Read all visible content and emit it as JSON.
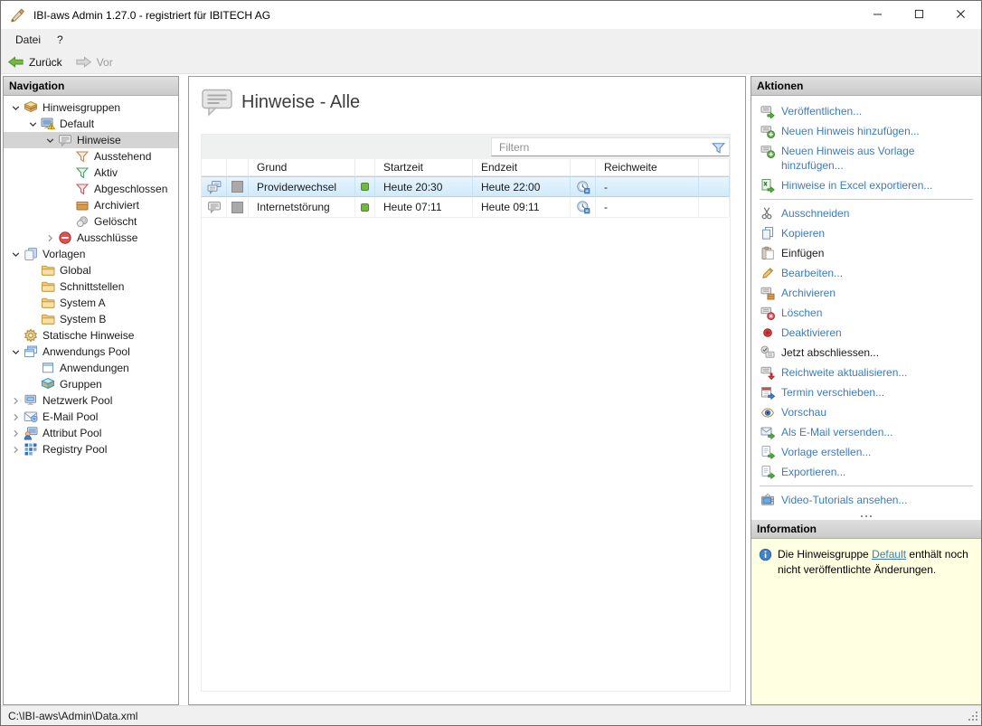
{
  "colors": {
    "link": "#3a7cbf",
    "selection": "#d5ebfa",
    "info_bg": "#ffffe1",
    "status_green": "#72b840",
    "panel_header_bg": "#d5d5d5"
  },
  "window": {
    "title": "IBI-aws Admin 1.27.0 - registriert für IBITECH AG",
    "icon": "app-logo",
    "controls": [
      {
        "name": "minimize",
        "icon": "win-min"
      },
      {
        "name": "maximize",
        "icon": "win-max"
      },
      {
        "name": "close",
        "icon": "win-close"
      }
    ]
  },
  "menu": {
    "items": [
      "Datei",
      "?"
    ]
  },
  "toolbar": {
    "back_label": "Zurück",
    "back_icon": "back-arrow",
    "forward_label": "Vor",
    "forward_icon": "fwd-arrow"
  },
  "navigation": {
    "header": "Navigation",
    "tree": [
      {
        "label": "Hinweisgruppen",
        "level": 0,
        "chevron": "expanded",
        "icon": "stack-yellow"
      },
      {
        "label": "Default",
        "level": 1,
        "chevron": "expanded",
        "icon": "monitor-warning"
      },
      {
        "label": "Hinweise",
        "level": 2,
        "chevron": "expanded",
        "icon": "note-bubble",
        "selected": true
      },
      {
        "label": "Ausstehend",
        "level": 3,
        "chevron": null,
        "icon": "funnel-orange"
      },
      {
        "label": "Aktiv",
        "level": 3,
        "chevron": null,
        "icon": "funnel-green"
      },
      {
        "label": "Abgeschlossen",
        "level": 3,
        "chevron": null,
        "icon": "funnel-red"
      },
      {
        "label": "Archiviert",
        "level": 3,
        "chevron": null,
        "icon": "archive-box"
      },
      {
        "label": "Gelöscht",
        "level": 3,
        "chevron": null,
        "icon": "coins-gray"
      },
      {
        "label": "Ausschlüsse",
        "level": 2,
        "chevron": "collapsed",
        "icon": "exclude-red"
      },
      {
        "label": "Vorlagen",
        "level": 0,
        "chevron": "expanded",
        "icon": "pages-blue"
      },
      {
        "label": "Global",
        "level": 1,
        "chevron": null,
        "icon": "folder"
      },
      {
        "label": "Schnittstellen",
        "level": 1,
        "chevron": null,
        "icon": "folder"
      },
      {
        "label": "System A",
        "level": 1,
        "chevron": null,
        "icon": "folder"
      },
      {
        "label": "System B",
        "level": 1,
        "chevron": null,
        "icon": "folder"
      },
      {
        "label": "Statische Hinweise",
        "level": 0,
        "chevron": null,
        "icon": "gear-gold"
      },
      {
        "label": "Anwendungs Pool",
        "level": 0,
        "chevron": "expanded",
        "icon": "windows-two"
      },
      {
        "label": "Anwendungen",
        "level": 1,
        "chevron": null,
        "icon": "window-single"
      },
      {
        "label": "Gruppen",
        "level": 1,
        "chevron": null,
        "icon": "stack-teal"
      },
      {
        "label": "Netzwerk Pool",
        "level": 0,
        "chevron": "collapsed",
        "icon": "monitor-network"
      },
      {
        "label": "E-Mail Pool",
        "level": 0,
        "chevron": "collapsed",
        "icon": "envelope-at"
      },
      {
        "label": "Attribut Pool",
        "level": 0,
        "chevron": "collapsed",
        "icon": "person-monitor"
      },
      {
        "label": "Registry Pool",
        "level": 0,
        "chevron": "collapsed",
        "icon": "grid-blue"
      }
    ]
  },
  "main": {
    "title": "Hinweise - Alle",
    "title_icon": "notes-large",
    "filter": {
      "placeholder": "Filtern",
      "icon": "filter-funnel"
    },
    "table": {
      "columns": [
        "",
        "",
        "Grund",
        "",
        "Startzeit",
        "Endzeit",
        "",
        "Reichweite",
        ""
      ],
      "rows": [
        {
          "type_icon": "conversation",
          "category_color": "#a9a9a9",
          "grund": "Providerwechsel",
          "status": "green",
          "startzeit": "Heute 20:30",
          "endzeit": "Heute 22:00",
          "reach_icon": "clock-reach",
          "reichweite": "-",
          "selected": true
        },
        {
          "type_icon": "note-bubble",
          "category_color": "#a9a9a9",
          "grund": "Internetstörung",
          "status": "green",
          "startzeit": "Heute 07:11",
          "endzeit": "Heute 09:11",
          "reach_icon": "clock-reach",
          "reichweite": "-",
          "selected": false
        }
      ]
    }
  },
  "actions": {
    "header": "Aktionen",
    "items": [
      {
        "label": "Veröffentlichen...",
        "icon": "act-publish",
        "enabled": true
      },
      {
        "label": "Neuen Hinweis hinzufügen...",
        "icon": "act-add",
        "enabled": true
      },
      {
        "label": "Neuen Hinweis aus Vorlage hinzufügen...",
        "icon": "act-add",
        "enabled": true
      },
      {
        "label": "Hinweise in Excel exportieren...",
        "icon": "act-excel",
        "enabled": true,
        "separator_after": true
      },
      {
        "label": "Ausschneiden",
        "icon": "act-cut",
        "enabled": true
      },
      {
        "label": "Kopieren",
        "icon": "act-copy",
        "enabled": true
      },
      {
        "label": "Einfügen",
        "icon": "act-paste",
        "enabled": false
      },
      {
        "label": "Bearbeiten...",
        "icon": "act-edit",
        "enabled": true
      },
      {
        "label": "Archivieren",
        "icon": "act-archive",
        "enabled": true
      },
      {
        "label": "Löschen",
        "icon": "act-delete",
        "enabled": true
      },
      {
        "label": "Deaktivieren",
        "icon": "act-deactivate",
        "enabled": true
      },
      {
        "label": "Jetzt abschliessen...",
        "icon": "act-complete",
        "enabled": false
      },
      {
        "label": "Reichweite aktualisieren...",
        "icon": "act-reach",
        "enabled": true
      },
      {
        "label": "Termin verschieben...",
        "icon": "act-calendar",
        "enabled": true
      },
      {
        "label": "Vorschau",
        "icon": "act-preview",
        "enabled": true
      },
      {
        "label": "Als E-Mail versenden...",
        "icon": "act-email",
        "enabled": true
      },
      {
        "label": "Vorlage erstellen...",
        "icon": "act-template",
        "enabled": true
      },
      {
        "label": "Exportieren...",
        "icon": "act-export",
        "enabled": true,
        "separator_after": true
      },
      {
        "label": "Video-Tutorials ansehen...",
        "icon": "act-video",
        "enabled": true
      }
    ]
  },
  "information": {
    "header": "Information",
    "icon": "info-circle",
    "text_before": "Die Hinweisgruppe ",
    "link": "Default",
    "text_after": " enthält noch nicht veröffentlichte Änderungen."
  },
  "statusbar": {
    "path": "C:\\IBI-aws\\Admin\\Data.xml"
  }
}
